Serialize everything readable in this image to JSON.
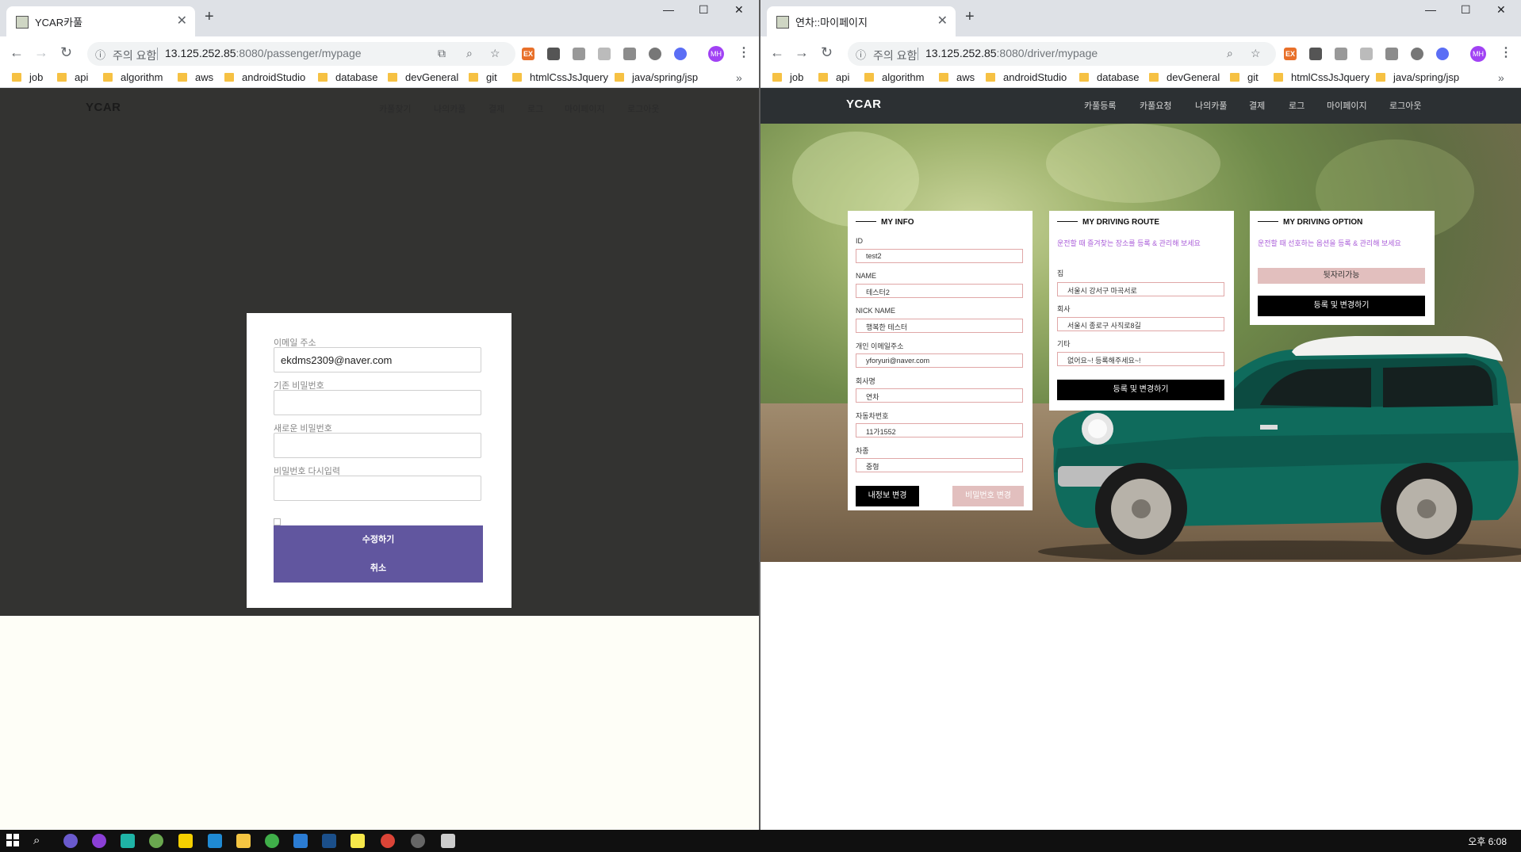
{
  "left_window": {
    "tab_title": "YCAR카풀",
    "url_warning": "주의 요함",
    "url_host": "13.125.252.85",
    "url_rest": ":8080/passenger/mypage",
    "site": {
      "logo": "YCAR",
      "nav": [
        "카풀찾기",
        "나의카풀",
        "결제",
        "로그",
        "마이페이지",
        "로그아웃"
      ]
    },
    "form": {
      "email_label": "이메일 주소",
      "email_value": "ekdms2309@naver.com",
      "old_pw_label": "기존 비밀번호",
      "new_pw_label": "새로운 비밀번호",
      "confirm_pw_label": "비밀번호 다시입력",
      "submit_label": "수정하기",
      "cancel_label": "취소"
    }
  },
  "right_window": {
    "tab_title": "연차::마이페이지",
    "url_warning": "주의 요함",
    "url_host": "13.125.252.85",
    "url_rest": ":8080/driver/mypage",
    "site": {
      "logo": "YCAR",
      "nav": [
        "카풀등록",
        "카풀요청",
        "나의카풀",
        "결제",
        "로그",
        "마이페이지",
        "로그아웃"
      ]
    },
    "my_info": {
      "heading": "MY INFO",
      "id_label": "ID",
      "id_value": "test2",
      "name_label": "NAME",
      "name_value": "테스터2",
      "nick_label": "NICK NAME",
      "nick_value": "행복한 테스터",
      "email_label": "개인 이메일주소",
      "email_value": "yforyuri@naver.com",
      "company_label": "회사명",
      "company_value": "연차",
      "car_no_label": "자동차번호",
      "car_no_value": "11가1552",
      "car_type_label": "차종",
      "car_type_value": "중형",
      "edit_info_btn": "내정보 변경",
      "edit_pw_btn": "비밀번호 변경"
    },
    "my_route": {
      "heading": "MY DRIVING ROUTE",
      "hint": "운전할 때 즐겨찾는 장소를 등록 & 관리해 보세요",
      "home_label": "집",
      "home_value": "서울시 강서구 마곡서로",
      "work_label": "회사",
      "work_value": "서울시 종로구 사직로8길",
      "etc_label": "기타",
      "etc_value": "없어요~! 등록해주세요~!",
      "save_btn": "등록 및 변경하기"
    },
    "my_option": {
      "heading": "MY DRIVING OPTION",
      "hint": "운전할 때 선호하는 옵션을 등록 & 관리해 보세요",
      "option_tag": "뒷자리가능",
      "save_btn": "등록 및 변경하기"
    }
  },
  "bookmarks": [
    "job",
    "api",
    "algorithm",
    "aws",
    "androidStudio",
    "database",
    "devGeneral",
    "git",
    "htmlCssJsJquery",
    "java/spring/jsp"
  ],
  "bookmarks_more": "»",
  "profile_initials": "MH",
  "ext_badge": "EX",
  "taskbar": {
    "clock": "오후 6:08"
  },
  "colors": {
    "accent_purple": "#61569f",
    "hint_purple": "#a95bd8",
    "pink_button": "#e2bfbe",
    "dark_bg": "#333331",
    "header_dark": "#2c3033"
  }
}
